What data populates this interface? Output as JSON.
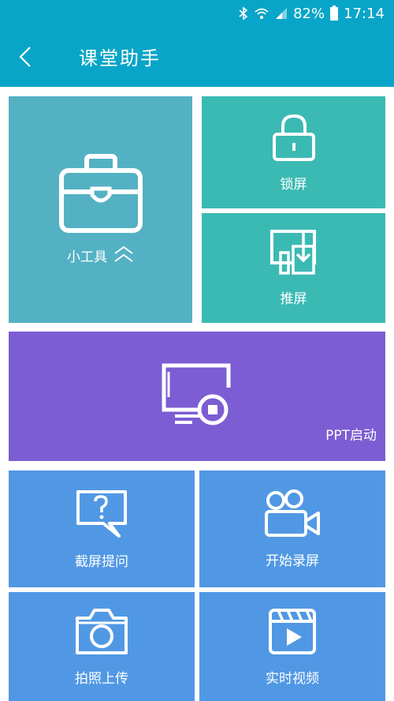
{
  "status_bar": {
    "battery_percent": "82%",
    "time": "17:14",
    "icons": [
      "bluetooth-icon",
      "wifi-icon",
      "signal-icon",
      "battery-icon"
    ]
  },
  "app_bar": {
    "title": "课堂助手",
    "back_icon": "back-arrow-icon"
  },
  "tiles": {
    "tools": {
      "label": "小工具",
      "icon": "toolbox-icon",
      "color": "#54b1c4"
    },
    "lock_screen": {
      "label": "锁屏",
      "icon": "lock-icon",
      "color": "#3bbab3"
    },
    "push_screen": {
      "label": "推屏",
      "icon": "push-screen-icon",
      "color": "#3bbab3"
    },
    "ppt_start": {
      "label": "PPT启动",
      "icon": "presentation-icon",
      "color": "#7c5dd3"
    },
    "screenshot_question": {
      "label": "截屏提问",
      "icon": "question-bubble-icon",
      "color": "#5198e4"
    },
    "start_recording": {
      "label": "开始录屏",
      "icon": "video-camera-icon",
      "color": "#5198e4"
    },
    "photo_upload": {
      "label": "拍照上传",
      "icon": "camera-icon",
      "color": "#5198e4"
    },
    "live_video": {
      "label": "实时视频",
      "icon": "video-play-icon",
      "color": "#5198e4"
    }
  },
  "colors": {
    "primary": "#09a5c8"
  }
}
